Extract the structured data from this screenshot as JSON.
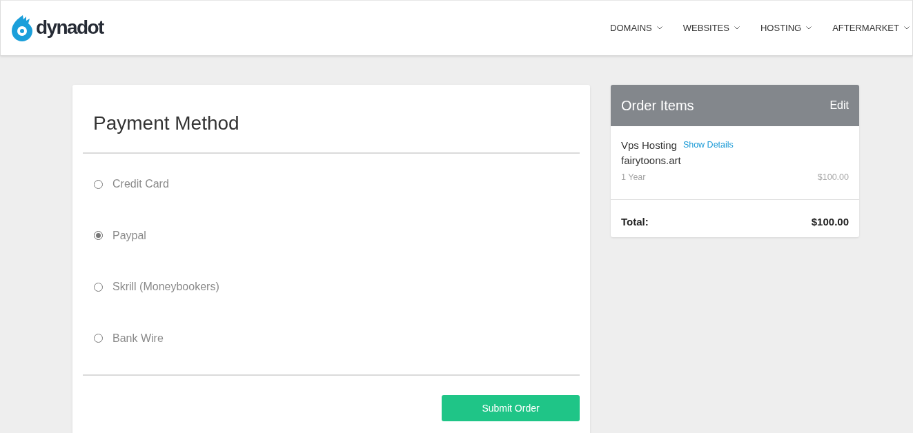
{
  "header": {
    "logo": {
      "text": "dynadot"
    },
    "nav": [
      {
        "label": "DOMAINS"
      },
      {
        "label": "WEBSITES"
      },
      {
        "label": "HOSTING"
      },
      {
        "label": "AFTERMARKET"
      }
    ]
  },
  "payment": {
    "title": "Payment Method",
    "options": [
      {
        "label": "Credit Card",
        "selected": false
      },
      {
        "label": "Paypal",
        "selected": true
      },
      {
        "label": "Skrill (Moneybookers)",
        "selected": false
      },
      {
        "label": "Bank Wire",
        "selected": false
      }
    ],
    "submit": "Submit Order"
  },
  "order": {
    "title": "Order Items",
    "edit": "Edit",
    "items": [
      {
        "name": "Vps Hosting",
        "details_link": "Show Details",
        "domain": "fairytoons.art",
        "term": "1 Year",
        "price": "$100.00"
      }
    ],
    "total_label": "Total:",
    "total": "$100.00"
  }
}
